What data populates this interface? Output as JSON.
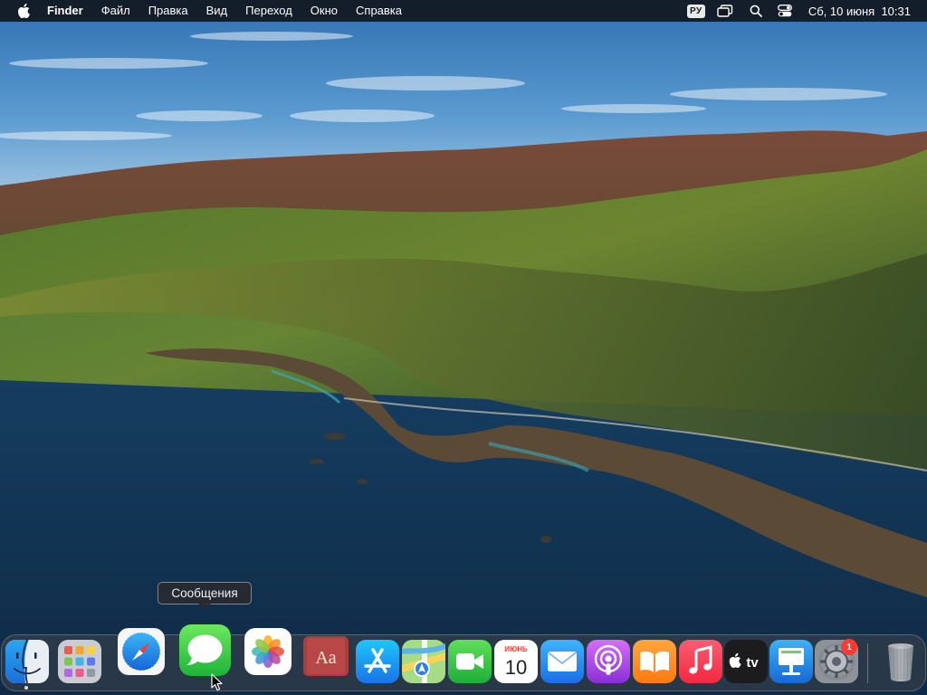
{
  "menubar": {
    "app_name": "Finder",
    "menus": [
      "Файл",
      "Правка",
      "Вид",
      "Переход",
      "Окно",
      "Справка"
    ],
    "input_source": "РУ",
    "date": "Сб, 10 июня",
    "time": "10:31"
  },
  "dock": {
    "tooltip": "Сообщения",
    "calendar_month": "ИЮНЬ",
    "calendar_day": "10",
    "dictionary_text": "Aa",
    "tv_text": "tv",
    "settings_badge": "1"
  },
  "colors": {
    "menubar_bg": "#12181f",
    "sky": "#3f86c4",
    "ocean": "#1c4a70",
    "mountain": "#4d6b2a",
    "badge": "#ff3b30"
  }
}
